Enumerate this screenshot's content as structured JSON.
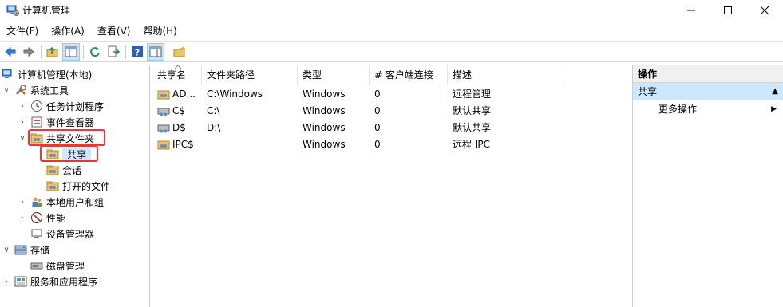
{
  "window": {
    "title": "计算机管理"
  },
  "menu": [
    "文件(F)",
    "操作(A)",
    "查看(V)",
    "帮助(H)"
  ],
  "toolbar": {
    "buttons": [
      "back-icon",
      "forward-icon",
      "up-folder-icon",
      "show-hide-tree-icon",
      "refresh-icon",
      "export-list-icon",
      "help-icon",
      "show-hide-action-pane-icon",
      "new-share-icon"
    ]
  },
  "tree": {
    "root": "计算机管理(本地)",
    "system_tools": "系统工具",
    "task_scheduler": "任务计划程序",
    "event_viewer": "事件查看器",
    "shared_folders": "共享文件夹",
    "shares": "共享",
    "sessions": "会话",
    "open_files": "打开的文件",
    "local_users": "本地用户和组",
    "performance": "性能",
    "device_manager": "设备管理器",
    "storage": "存储",
    "disk_management": "磁盘管理",
    "services_apps": "服务和应用程序"
  },
  "list": {
    "columns": [
      "共享名",
      "文件夹路径",
      "类型",
      "# 客户端连接",
      "描述"
    ],
    "rows": [
      {
        "name": "AD...",
        "path": "C:\\Windows",
        "type": "Windows",
        "clients": "0",
        "desc": "远程管理"
      },
      {
        "name": "C$",
        "path": "C:\\",
        "type": "Windows",
        "clients": "0",
        "desc": "默认共享"
      },
      {
        "name": "D$",
        "path": "D:\\",
        "type": "Windows",
        "clients": "0",
        "desc": "默认共享"
      },
      {
        "name": "IPC$",
        "path": "",
        "type": "Windows",
        "clients": "0",
        "desc": "远程 IPC"
      }
    ]
  },
  "actions": {
    "header": "操作",
    "section": "共享",
    "more": "更多操作"
  },
  "colors": {
    "highlight_box": "#e53935",
    "selection": "#cce8ff"
  }
}
